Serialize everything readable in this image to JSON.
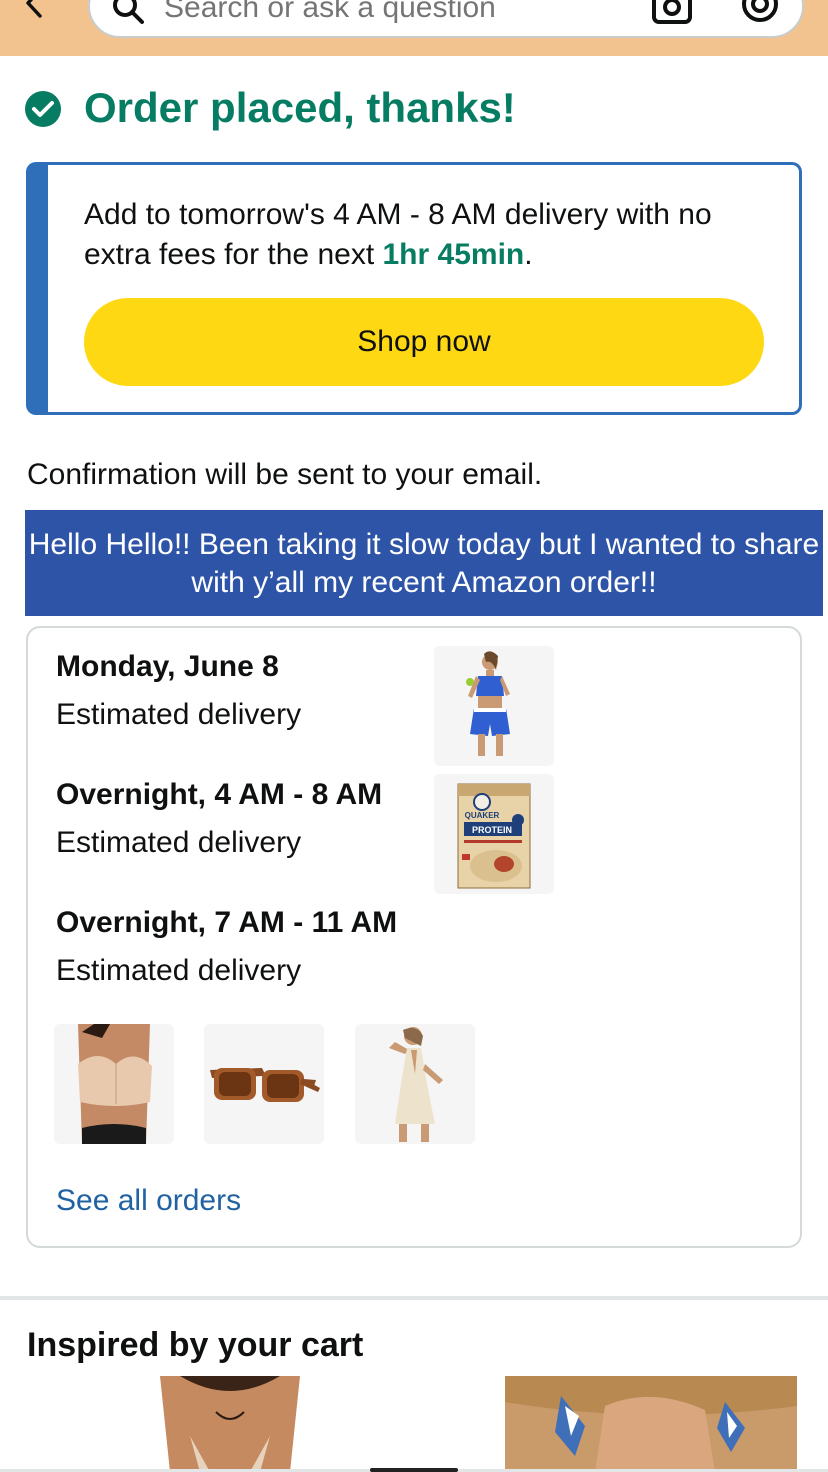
{
  "search": {
    "placeholder": "Search or ask a question"
  },
  "order": {
    "title": "Order placed, thanks!"
  },
  "promo": {
    "text_prefix": "Add to tomorrow's 4 AM - 8 AM delivery with no extra fees for the next ",
    "timer": "1hr 45min",
    "text_suffix": ".",
    "button_label": "Shop now"
  },
  "confirmation": "Confirmation will be sent to your email.",
  "caption": "Hello Hello!! Been taking it slow today but I wanted to share with y’all my recent Amazon order!!",
  "deliveries": [
    {
      "date": "Monday, June 8",
      "status": "Estimated delivery"
    },
    {
      "date": "Overnight, 4 AM - 8 AM",
      "status": "Estimated delivery"
    },
    {
      "date": "Overnight, 7 AM - 11 AM",
      "status": "Estimated delivery"
    }
  ],
  "products": {
    "workout_set": "workout-set-image",
    "oatmeal": "oatmeal-box-image",
    "bra": "strapless-bra-image",
    "sunglasses": "sunglasses-image",
    "romper": "white-romper-image"
  },
  "oatmeal_box": {
    "brand": "QUAKER",
    "product": "PROTEIN"
  },
  "see_all": "See all orders",
  "inspired": {
    "title": "Inspired by your cart"
  },
  "colors": {
    "header": "#f2c38f",
    "success": "#067d62",
    "promo_border": "#2f6fba",
    "button": "#ffd814",
    "link": "#2162a1",
    "caption_bg": "#2e54a8"
  }
}
